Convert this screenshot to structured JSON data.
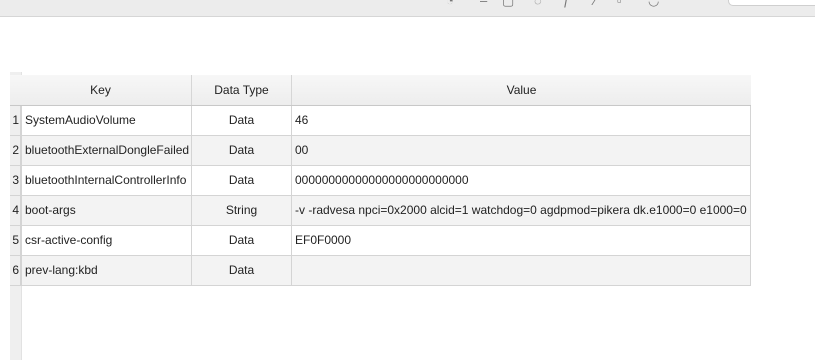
{
  "columns": {
    "key": "Key",
    "type": "Data Type",
    "value": "Value"
  },
  "rows": [
    {
      "num": "1",
      "key": "SystemAudioVolume",
      "type": "Data",
      "value": "46"
    },
    {
      "num": "2",
      "key": "bluetoothExternalDongleFailed",
      "type": "Data",
      "value": "00"
    },
    {
      "num": "3",
      "key": "bluetoothInternalControllerInfo",
      "type": "Data",
      "value": "00000000000000000000000000"
    },
    {
      "num": "4",
      "key": "boot-args",
      "type": "String",
      "value": "-v -radvesa npci=0x2000 alcid=1 watchdog=0 agdpmod=pikera dk.e1000=0 e1000=0"
    },
    {
      "num": "5",
      "key": "csr-active-config",
      "type": "Data",
      "value": "EF0F0000"
    },
    {
      "num": "6",
      "key": "prev-lang:kbd",
      "type": "Data",
      "value": ""
    }
  ]
}
